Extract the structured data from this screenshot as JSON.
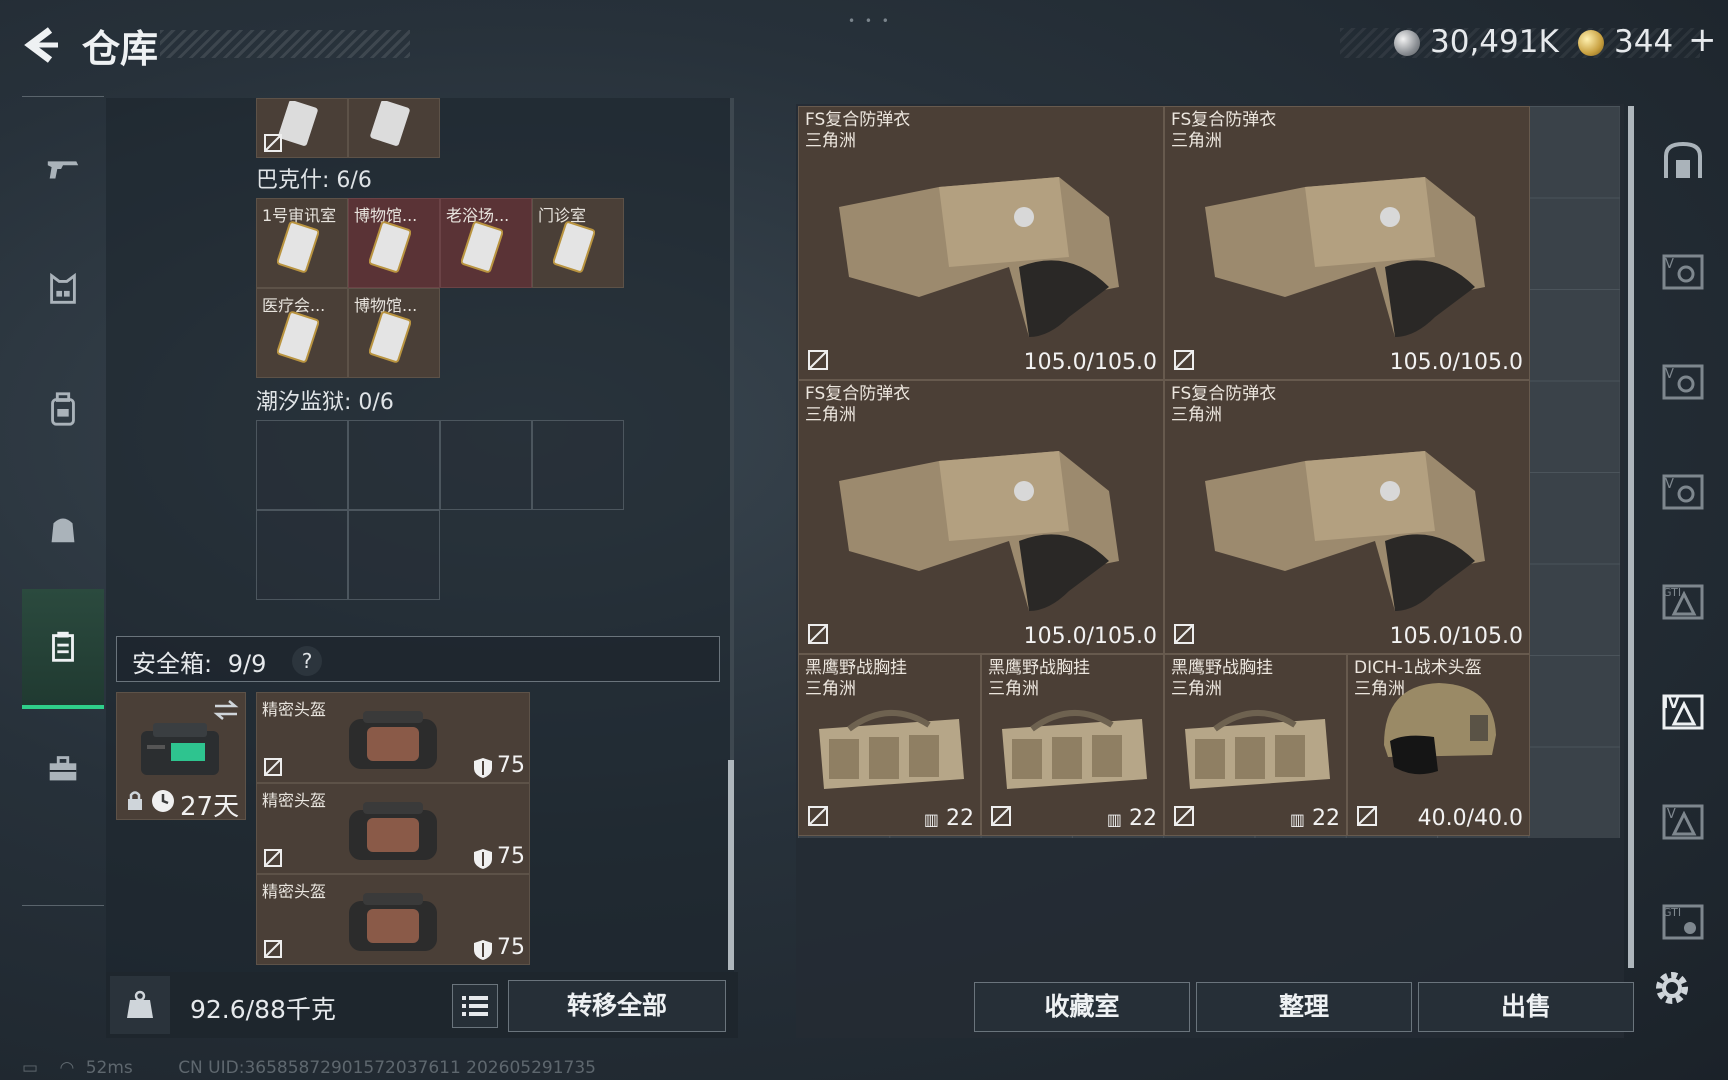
{
  "header": {
    "title": "仓库",
    "silver_value": "30,491K",
    "gold_value": "344",
    "plus": "+"
  },
  "left_panel": {
    "top_group": {
      "cells": [
        {
          "label": ""
        },
        {
          "label": ""
        }
      ]
    },
    "group_bakeshi": {
      "label": "巴克什: 6/6",
      "cells": [
        {
          "label": "1号审讯室"
        },
        {
          "label": "博物馆..."
        },
        {
          "label": "老浴场..."
        },
        {
          "label": "门诊室"
        },
        {
          "label": "医疗会..."
        },
        {
          "label": "博物馆..."
        }
      ]
    },
    "group_chaoxi": {
      "label": "潮汐监狱: 0/6"
    },
    "safebox": {
      "label": "安全箱:",
      "count": "9/9",
      "help": "?",
      "days": "27天"
    },
    "safebox_items": [
      {
        "name": "精密头盔",
        "durability": "75"
      },
      {
        "name": "精密头盔",
        "durability": "75"
      },
      {
        "name": "精密头盔",
        "durability": "75"
      }
    ],
    "weight": "92.6/88千克",
    "transfer_all": "转移全部"
  },
  "storage_items": [
    {
      "name": "FS复合防弹衣",
      "sub": "三角洲",
      "value": "105.0/105.0"
    },
    {
      "name": "FS复合防弹衣",
      "sub": "三角洲",
      "value": "105.0/105.0"
    },
    {
      "name": "FS复合防弹衣",
      "sub": "三角洲",
      "value": "105.0/105.0"
    },
    {
      "name": "FS复合防弹衣",
      "sub": "三角洲",
      "value": "105.0/105.0"
    },
    {
      "name": "黑鹰野战胸挂",
      "sub": "三角洲",
      "value": "22"
    },
    {
      "name": "黑鹰野战胸挂",
      "sub": "三角洲",
      "value": "22"
    },
    {
      "name": "黑鹰野战胸挂",
      "sub": "三角洲",
      "value": "22"
    },
    {
      "name": "DICH-1战术头盔",
      "sub": "三角洲",
      "value": "40.0/40.0"
    }
  ],
  "right_nav": [
    "V",
    "V",
    "V",
    "GTI",
    "IV",
    "IV",
    "GTI"
  ],
  "actions": {
    "collection": "收藏室",
    "sort": "整理",
    "sell": "出售"
  },
  "status": {
    "ping": "52ms",
    "uid": "CN UID:36585872901572037611 202605291735"
  },
  "colors": {
    "accent_green": "#2fcf8a",
    "item_brown": "#4b3f36",
    "item_red": "#5a3336"
  }
}
